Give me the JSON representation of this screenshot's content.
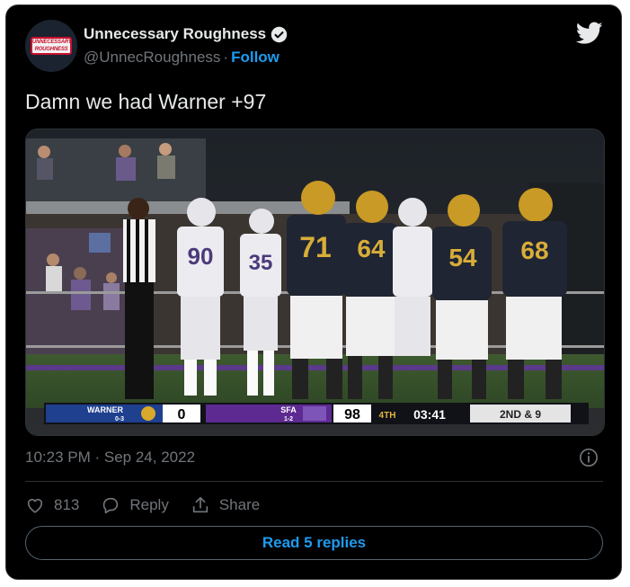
{
  "account": {
    "display_name": "Unnecessary Roughness",
    "handle": "@UnnecRoughness",
    "follow_label": "Follow",
    "avatar_text_top": "UNNECESSARY",
    "avatar_text_bottom": "ROUGHNESS"
  },
  "tweet": {
    "text": "Damn we had Warner +97",
    "timestamp": "10:23 PM · Sep 24, 2022"
  },
  "scoreboard": {
    "away_team": "WARNER",
    "away_record": "0-3",
    "away_score": "0",
    "home_team": "SFA",
    "home_record": "1-2",
    "home_score": "98",
    "quarter": "4TH",
    "clock": "03:41",
    "down_distance": "2ND & 9"
  },
  "jerseys": [
    "90",
    "35",
    "71",
    "64",
    "54",
    "68"
  ],
  "actions": {
    "like_count": "813",
    "reply_label": "Reply",
    "share_label": "Share",
    "read_replies_label": "Read 5 replies"
  },
  "colors": {
    "link_blue": "#1d9bf0",
    "text": "#e7e9ea",
    "muted": "#71767b",
    "sfa_purple": "#5c2a91",
    "warner_blue": "#1f3f8f"
  }
}
